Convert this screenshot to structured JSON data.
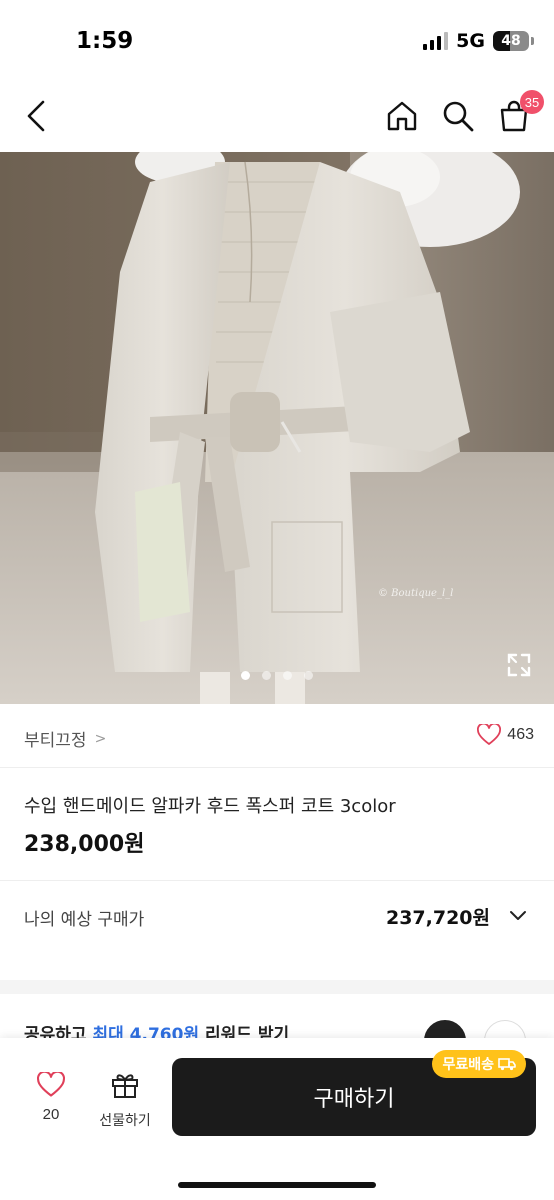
{
  "status_bar": {
    "time": "1:59",
    "network": "5G",
    "battery": "48",
    "battery_level_percent": 48
  },
  "nav": {
    "back_icon": "chevron-left-icon",
    "home_icon": "home-icon",
    "search_icon": "search-icon",
    "cart_icon": "shopping-bag-icon",
    "cart_badge": "35",
    "cart_badge_color": "#f0506a"
  },
  "gallery": {
    "total_images": 4,
    "active_index": 0,
    "expand_icon": "expand-icon",
    "watermark": "© Boutique_l_l"
  },
  "brand": {
    "name": "부티끄정",
    "chevron": ">",
    "like_count": "463",
    "like_icon": "heart-outline-icon",
    "like_color": "#e0405a"
  },
  "product": {
    "title": "수입 핸드메이드 알파카 후드 폭스퍼 코트 3color",
    "price": "238,000원"
  },
  "estimate": {
    "label": "나의 예상 구매가",
    "value": "237,720원",
    "chevron_icon": "chevron-down-icon"
  },
  "reward": {
    "prefix": "공유하고 ",
    "highlight": "최대 4,760원",
    "suffix": " 리워드 받기",
    "accent_color": "#2f6fe0"
  },
  "bottom_bar": {
    "like_count": "20",
    "like_icon": "heart-outline-icon",
    "gift_label": "선물하기",
    "gift_icon": "gift-icon",
    "buy_label": "구매하기",
    "free_shipping_label": "무료배송",
    "truck_icon": "truck-icon",
    "free_shipping_color": "#ffc21a"
  }
}
